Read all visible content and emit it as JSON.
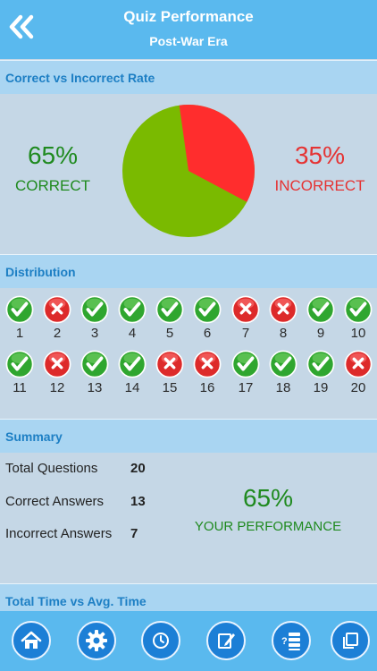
{
  "header": {
    "title": "Quiz Performance",
    "subtitle": "Post-War Era"
  },
  "rate": {
    "section_title": "Correct vs Incorrect Rate",
    "correct_pct_label": "65%",
    "correct_label": "CORRECT",
    "incorrect_pct_label": "35%",
    "incorrect_label": "INCORRECT",
    "correct_fraction": 0.65,
    "incorrect_fraction": 0.35,
    "correct_color": "#7aba00",
    "incorrect_color": "#ff2d2d"
  },
  "distribution": {
    "section_title": "Distribution",
    "items": [
      {
        "num": "1",
        "correct": true
      },
      {
        "num": "2",
        "correct": false
      },
      {
        "num": "3",
        "correct": true
      },
      {
        "num": "4",
        "correct": true
      },
      {
        "num": "5",
        "correct": true
      },
      {
        "num": "6",
        "correct": true
      },
      {
        "num": "7",
        "correct": false
      },
      {
        "num": "8",
        "correct": false
      },
      {
        "num": "9",
        "correct": true
      },
      {
        "num": "10",
        "correct": true
      },
      {
        "num": "11",
        "correct": true
      },
      {
        "num": "12",
        "correct": false
      },
      {
        "num": "13",
        "correct": true
      },
      {
        "num": "14",
        "correct": true
      },
      {
        "num": "15",
        "correct": false
      },
      {
        "num": "16",
        "correct": false
      },
      {
        "num": "17",
        "correct": true
      },
      {
        "num": "18",
        "correct": true
      },
      {
        "num": "19",
        "correct": true
      },
      {
        "num": "20",
        "correct": false
      }
    ]
  },
  "summary": {
    "section_title": "Summary",
    "total_label": "Total Questions",
    "total_value": "20",
    "correct_label": "Correct Answers",
    "correct_value": "13",
    "incorrect_label": "Incorrect Answers",
    "incorrect_value": "7",
    "performance_pct": "65%",
    "performance_label": "YOUR PERFORMANCE"
  },
  "time": {
    "section_title": "Total Time vs Avg. Time"
  },
  "tabbar": {
    "icons": [
      "home-icon",
      "gear-icon",
      "clock-icon",
      "edit-icon",
      "quiz-list-icon",
      "copy-icon"
    ]
  },
  "colors": {
    "header_bg": "#5ab9ee",
    "section_bg": "#a9d5f2",
    "body_bg": "#c5d7e6",
    "accent_text": "#1d7fc4"
  }
}
